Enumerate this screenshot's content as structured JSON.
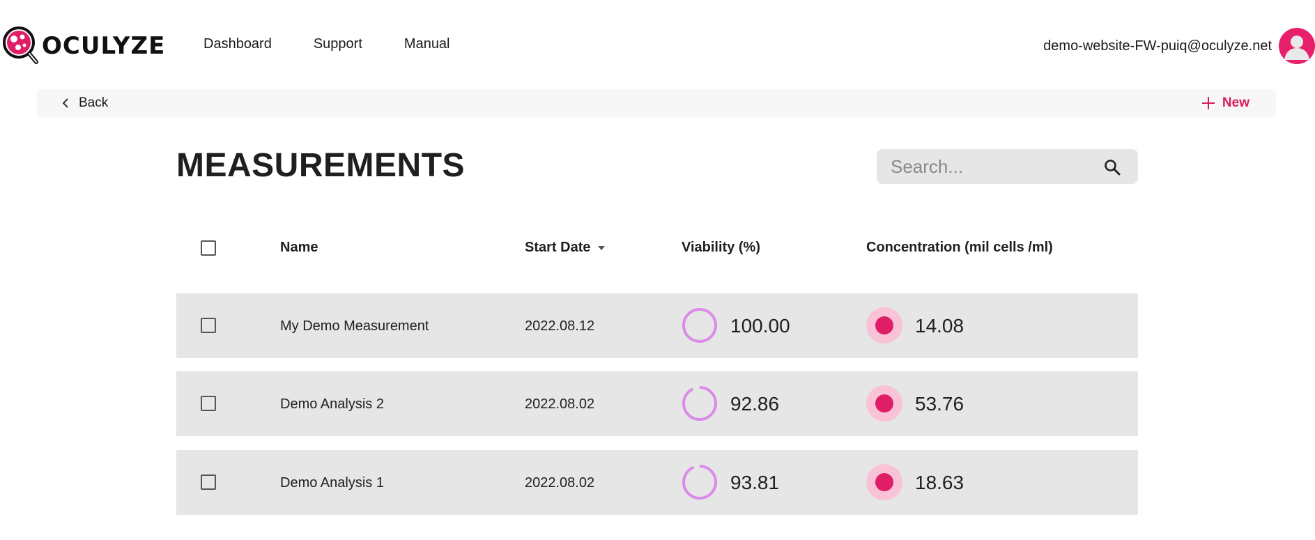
{
  "header": {
    "logo_text": "OCULYZE",
    "nav": [
      "Dashboard",
      "Support",
      "Manual"
    ],
    "user_email": "demo-website-FW-puiq@oculyze.net"
  },
  "action_bar": {
    "back_label": "Back",
    "new_label": "New"
  },
  "page": {
    "title": "MEASUREMENTS"
  },
  "search": {
    "placeholder": "Search..."
  },
  "table": {
    "columns": {
      "name": "Name",
      "start_date": "Start Date",
      "viability": "Viability (%)",
      "concentration": "Concentration (mil cells /ml)"
    },
    "sort_column": "start_date",
    "rows": [
      {
        "name": "My Demo Measurement",
        "start_date": "2022.08.12",
        "viability": "100.00",
        "viability_value": 100.0,
        "concentration": "14.08"
      },
      {
        "name": "Demo Analysis 2",
        "start_date": "2022.08.02",
        "viability": "92.86",
        "viability_value": 92.86,
        "concentration": "53.76"
      },
      {
        "name": "Demo Analysis 1",
        "start_date": "2022.08.02",
        "viability": "93.81",
        "viability_value": 93.81,
        "concentration": "18.63"
      }
    ]
  },
  "colors": {
    "brand": "#e01e68",
    "brand_light": "#f8c3d6",
    "viability_ring": "#db8be8",
    "row_bg": "#e6e6e6"
  }
}
